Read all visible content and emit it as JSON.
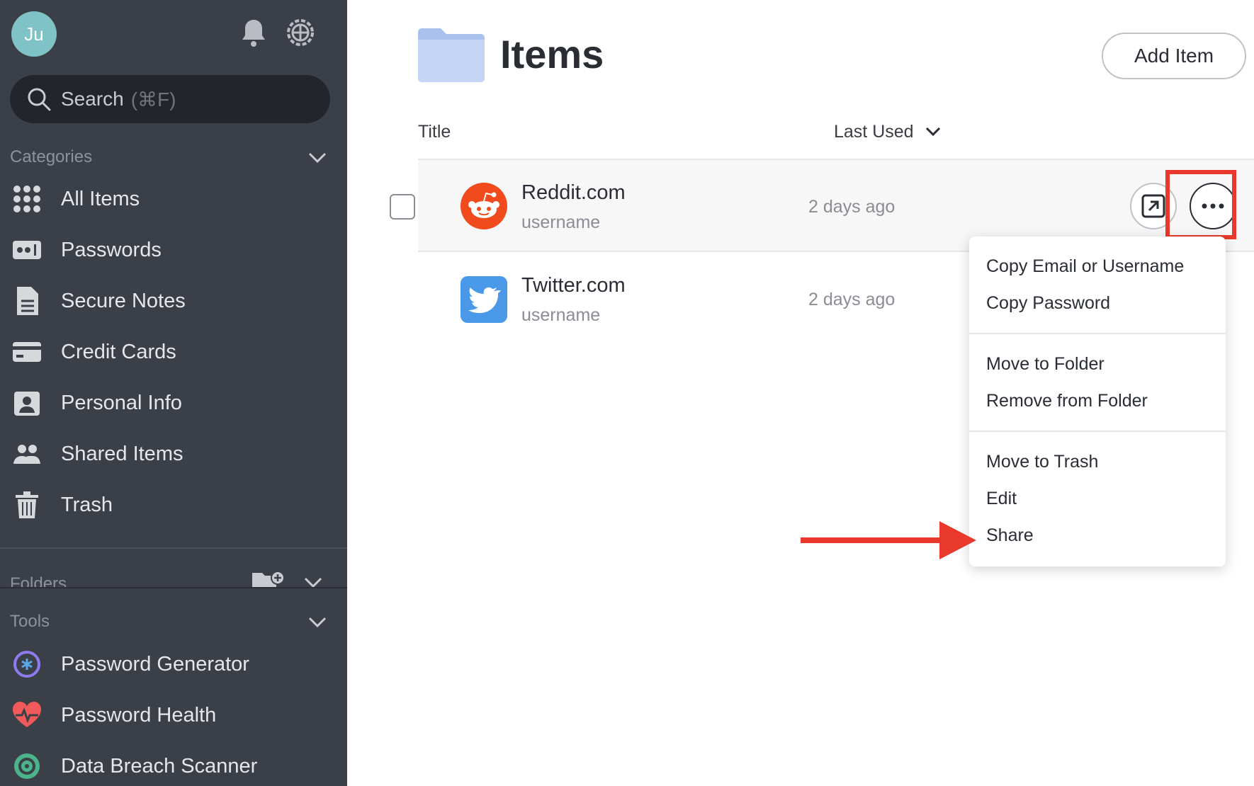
{
  "user": {
    "initials": "Ju"
  },
  "search": {
    "label": "Search",
    "shortcut": "(⌘F)"
  },
  "categories": {
    "heading": "Categories",
    "items": [
      {
        "label": "All Items",
        "icon": "grid-icon"
      },
      {
        "label": "Passwords",
        "icon": "password-icon"
      },
      {
        "label": "Secure Notes",
        "icon": "note-icon"
      },
      {
        "label": "Credit Cards",
        "icon": "credit-card-icon"
      },
      {
        "label": "Personal Info",
        "icon": "id-card-icon"
      },
      {
        "label": "Shared Items",
        "icon": "people-icon"
      },
      {
        "label": "Trash",
        "icon": "trash-icon"
      }
    ]
  },
  "folders": {
    "heading": "Folders"
  },
  "tools": {
    "heading": "Tools",
    "items": [
      {
        "label": "Password Generator",
        "icon": "password-generator-icon"
      },
      {
        "label": "Password Health",
        "icon": "heart-pulse-icon"
      },
      {
        "label": "Data Breach Scanner",
        "icon": "target-icon"
      }
    ]
  },
  "main": {
    "title": "Items",
    "add_button": "Add Item",
    "columns": {
      "title": "Title",
      "last_used": "Last Used"
    },
    "rows": [
      {
        "title": "Reddit.com",
        "subtitle": "username",
        "last_used": "2 days ago",
        "icon": "reddit-icon"
      },
      {
        "title": "Twitter.com",
        "subtitle": "username",
        "last_used": "2 days ago",
        "icon": "twitter-icon"
      }
    ]
  },
  "context_menu": {
    "groups": [
      [
        "Copy Email or Username",
        "Copy Password"
      ],
      [
        "Move to Folder",
        "Remove from Folder"
      ],
      [
        "Move to Trash",
        "Edit",
        "Share"
      ]
    ]
  },
  "colors": {
    "sidebar": "#3b3f47",
    "highlight": "#e8392c",
    "reddit": "#f04a1d",
    "twitter": "#4a99e9",
    "folder": "#c5d6f4"
  }
}
